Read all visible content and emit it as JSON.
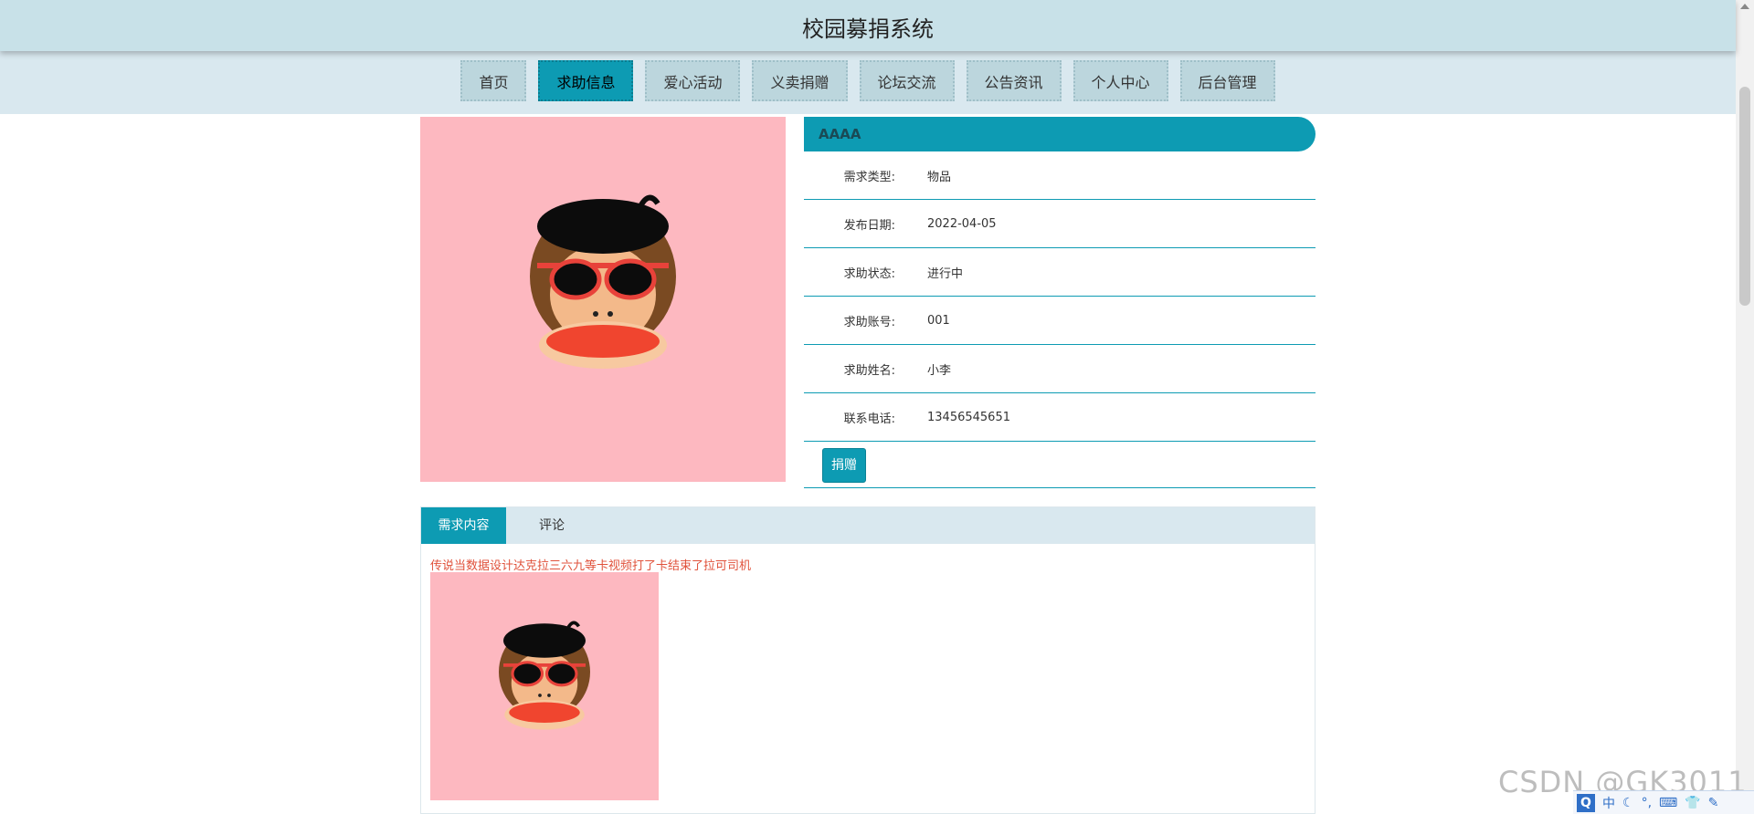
{
  "header": {
    "title": "校园募捐系统"
  },
  "nav": {
    "items": [
      {
        "label": "首页"
      },
      {
        "label": "求助信息"
      },
      {
        "label": "爱心活动"
      },
      {
        "label": "义卖捐赠"
      },
      {
        "label": "论坛交流"
      },
      {
        "label": "公告资讯"
      },
      {
        "label": "个人中心"
      },
      {
        "label": "后台管理"
      }
    ],
    "active_index": 1
  },
  "detail": {
    "title": "AAAA",
    "fields": [
      {
        "label": "需求类型:",
        "value": "物品"
      },
      {
        "label": "发布日期:",
        "value": "2022-04-05"
      },
      {
        "label": "求助状态:",
        "value": "进行中"
      },
      {
        "label": "求助账号:",
        "value": "001"
      },
      {
        "label": "求助姓名:",
        "value": "小李"
      },
      {
        "label": "联系电话:",
        "value": "13456545651"
      }
    ],
    "donate_button": "捐赠"
  },
  "tabs": {
    "items": [
      {
        "label": "需求内容"
      },
      {
        "label": "评论"
      }
    ],
    "active_index": 0
  },
  "content": {
    "text": "传说当数据设计达克拉三六九等卡视频打了卡结束了拉可司机"
  },
  "watermark": "CSDN @GK3011",
  "ime": {
    "mode_label": "中"
  },
  "colors": {
    "accent": "#0d9bb3",
    "header_bg": "#c8e1e8",
    "nav_bg": "#d9e8ef",
    "image_bg": "#fdb8c0",
    "content_text": "#e0523b"
  }
}
